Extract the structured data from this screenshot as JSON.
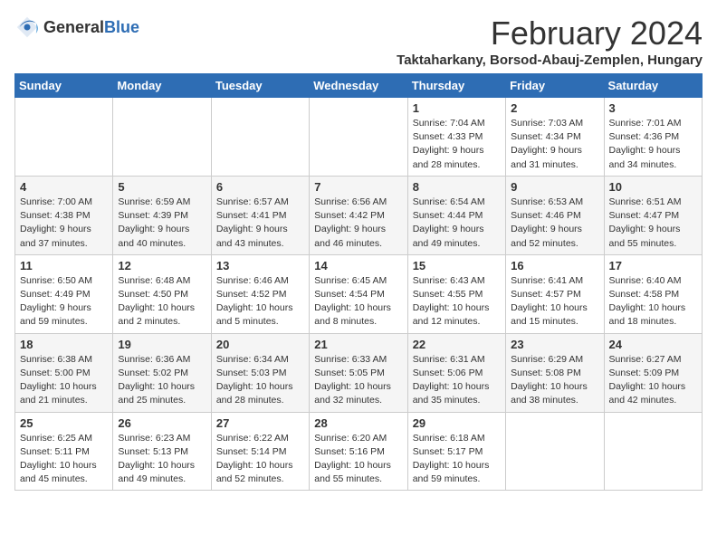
{
  "header": {
    "logo_general": "General",
    "logo_blue": "Blue",
    "title": "February 2024",
    "subtitle": "Taktaharkany, Borsod-Abauj-Zemplen, Hungary"
  },
  "calendar": {
    "weekdays": [
      "Sunday",
      "Monday",
      "Tuesday",
      "Wednesday",
      "Thursday",
      "Friday",
      "Saturday"
    ],
    "weeks": [
      [
        {
          "day": "",
          "info": ""
        },
        {
          "day": "",
          "info": ""
        },
        {
          "day": "",
          "info": ""
        },
        {
          "day": "",
          "info": ""
        },
        {
          "day": "1",
          "info": "Sunrise: 7:04 AM\nSunset: 4:33 PM\nDaylight: 9 hours\nand 28 minutes."
        },
        {
          "day": "2",
          "info": "Sunrise: 7:03 AM\nSunset: 4:34 PM\nDaylight: 9 hours\nand 31 minutes."
        },
        {
          "day": "3",
          "info": "Sunrise: 7:01 AM\nSunset: 4:36 PM\nDaylight: 9 hours\nand 34 minutes."
        }
      ],
      [
        {
          "day": "4",
          "info": "Sunrise: 7:00 AM\nSunset: 4:38 PM\nDaylight: 9 hours\nand 37 minutes."
        },
        {
          "day": "5",
          "info": "Sunrise: 6:59 AM\nSunset: 4:39 PM\nDaylight: 9 hours\nand 40 minutes."
        },
        {
          "day": "6",
          "info": "Sunrise: 6:57 AM\nSunset: 4:41 PM\nDaylight: 9 hours\nand 43 minutes."
        },
        {
          "day": "7",
          "info": "Sunrise: 6:56 AM\nSunset: 4:42 PM\nDaylight: 9 hours\nand 46 minutes."
        },
        {
          "day": "8",
          "info": "Sunrise: 6:54 AM\nSunset: 4:44 PM\nDaylight: 9 hours\nand 49 minutes."
        },
        {
          "day": "9",
          "info": "Sunrise: 6:53 AM\nSunset: 4:46 PM\nDaylight: 9 hours\nand 52 minutes."
        },
        {
          "day": "10",
          "info": "Sunrise: 6:51 AM\nSunset: 4:47 PM\nDaylight: 9 hours\nand 55 minutes."
        }
      ],
      [
        {
          "day": "11",
          "info": "Sunrise: 6:50 AM\nSunset: 4:49 PM\nDaylight: 9 hours\nand 59 minutes."
        },
        {
          "day": "12",
          "info": "Sunrise: 6:48 AM\nSunset: 4:50 PM\nDaylight: 10 hours\nand 2 minutes."
        },
        {
          "day": "13",
          "info": "Sunrise: 6:46 AM\nSunset: 4:52 PM\nDaylight: 10 hours\nand 5 minutes."
        },
        {
          "day": "14",
          "info": "Sunrise: 6:45 AM\nSunset: 4:54 PM\nDaylight: 10 hours\nand 8 minutes."
        },
        {
          "day": "15",
          "info": "Sunrise: 6:43 AM\nSunset: 4:55 PM\nDaylight: 10 hours\nand 12 minutes."
        },
        {
          "day": "16",
          "info": "Sunrise: 6:41 AM\nSunset: 4:57 PM\nDaylight: 10 hours\nand 15 minutes."
        },
        {
          "day": "17",
          "info": "Sunrise: 6:40 AM\nSunset: 4:58 PM\nDaylight: 10 hours\nand 18 minutes."
        }
      ],
      [
        {
          "day": "18",
          "info": "Sunrise: 6:38 AM\nSunset: 5:00 PM\nDaylight: 10 hours\nand 21 minutes."
        },
        {
          "day": "19",
          "info": "Sunrise: 6:36 AM\nSunset: 5:02 PM\nDaylight: 10 hours\nand 25 minutes."
        },
        {
          "day": "20",
          "info": "Sunrise: 6:34 AM\nSunset: 5:03 PM\nDaylight: 10 hours\nand 28 minutes."
        },
        {
          "day": "21",
          "info": "Sunrise: 6:33 AM\nSunset: 5:05 PM\nDaylight: 10 hours\nand 32 minutes."
        },
        {
          "day": "22",
          "info": "Sunrise: 6:31 AM\nSunset: 5:06 PM\nDaylight: 10 hours\nand 35 minutes."
        },
        {
          "day": "23",
          "info": "Sunrise: 6:29 AM\nSunset: 5:08 PM\nDaylight: 10 hours\nand 38 minutes."
        },
        {
          "day": "24",
          "info": "Sunrise: 6:27 AM\nSunset: 5:09 PM\nDaylight: 10 hours\nand 42 minutes."
        }
      ],
      [
        {
          "day": "25",
          "info": "Sunrise: 6:25 AM\nSunset: 5:11 PM\nDaylight: 10 hours\nand 45 minutes."
        },
        {
          "day": "26",
          "info": "Sunrise: 6:23 AM\nSunset: 5:13 PM\nDaylight: 10 hours\nand 49 minutes."
        },
        {
          "day": "27",
          "info": "Sunrise: 6:22 AM\nSunset: 5:14 PM\nDaylight: 10 hours\nand 52 minutes."
        },
        {
          "day": "28",
          "info": "Sunrise: 6:20 AM\nSunset: 5:16 PM\nDaylight: 10 hours\nand 55 minutes."
        },
        {
          "day": "29",
          "info": "Sunrise: 6:18 AM\nSunset: 5:17 PM\nDaylight: 10 hours\nand 59 minutes."
        },
        {
          "day": "",
          "info": ""
        },
        {
          "day": "",
          "info": ""
        }
      ]
    ]
  }
}
